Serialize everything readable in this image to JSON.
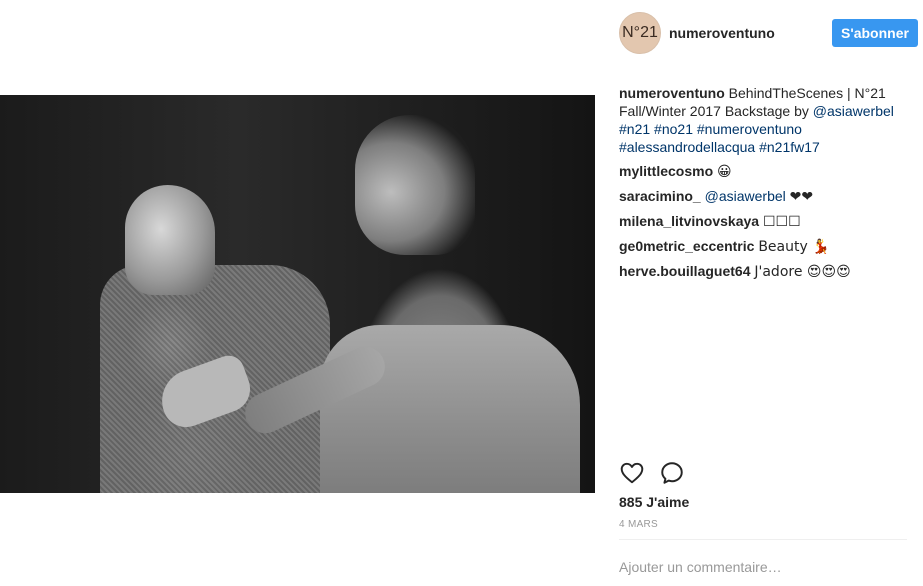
{
  "post": {
    "author": "numeroventuno",
    "avatar_text": "N°21",
    "follow_label": "S'abonner",
    "caption": {
      "user": "numeroventuno",
      "text": "BehindTheScenes | N°21 Fall/Winter 2017 Backstage by",
      "mention": "@asiawerbel",
      "hashtags": [
        "#n21",
        "#no21",
        "#numeroventuno",
        "#alessandrodellacqua",
        "#n21fw17"
      ]
    },
    "comments": [
      {
        "user": "mylittlecosmo",
        "text": "😀"
      },
      {
        "user": "saracimino_",
        "mention": "@asiawerbel",
        "text": "❤❤"
      },
      {
        "user": "milena_litvinovskaya",
        "text": "☐☐☐"
      },
      {
        "user": "ge0metric_eccentric",
        "text": "Beauty 💃"
      },
      {
        "user": "herve.bouillaguet64",
        "text": "J'adore 😍😍😍"
      }
    ],
    "likes": "885 J'aime",
    "date": "4 MARS",
    "add_comment_placeholder": "Ajouter un commentaire…"
  },
  "icons": {
    "like": "heart-icon",
    "comment": "speech-bubble-icon"
  },
  "colors": {
    "follow_button": "#3897f0",
    "link": "#003569",
    "muted": "#999999"
  }
}
